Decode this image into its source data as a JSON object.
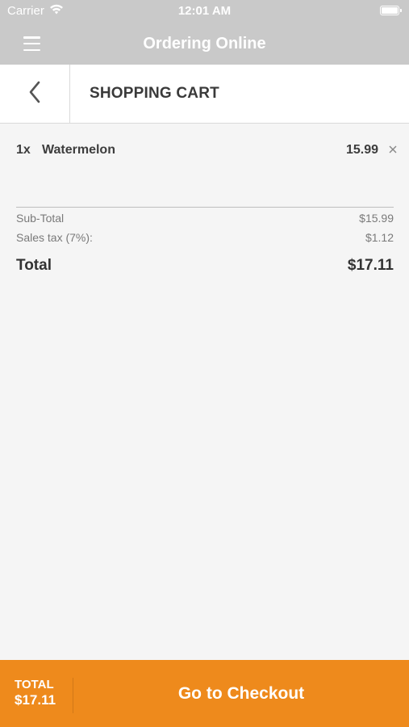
{
  "status_bar": {
    "carrier": "Carrier",
    "time": "12:01 AM",
    "icons": [
      "wifi-icon",
      "battery-icon"
    ]
  },
  "nav": {
    "title": "Ordering Online",
    "menu_icon": "hamburger-menu-icon"
  },
  "header": {
    "back_icon": "chevron-left-icon",
    "title": "SHOPPING CART"
  },
  "cart": {
    "items": [
      {
        "qty": "1x",
        "name": "Watermelon",
        "price": "15.99",
        "remove_icon": "close-icon"
      }
    ]
  },
  "summary": {
    "subtotal_label": "Sub-Total",
    "subtotal_value": "$15.99",
    "tax_label": "Sales tax (7%):",
    "tax_value": "$1.12",
    "total_label": "Total",
    "total_value": "$17.11"
  },
  "footer": {
    "total_label": "TOTAL",
    "total_value": "$17.11",
    "checkout_label": "Go to Checkout"
  },
  "colors": {
    "accent": "#ee8a1c",
    "topbar": "#c9c9c9",
    "background": "#f5f5f5"
  }
}
